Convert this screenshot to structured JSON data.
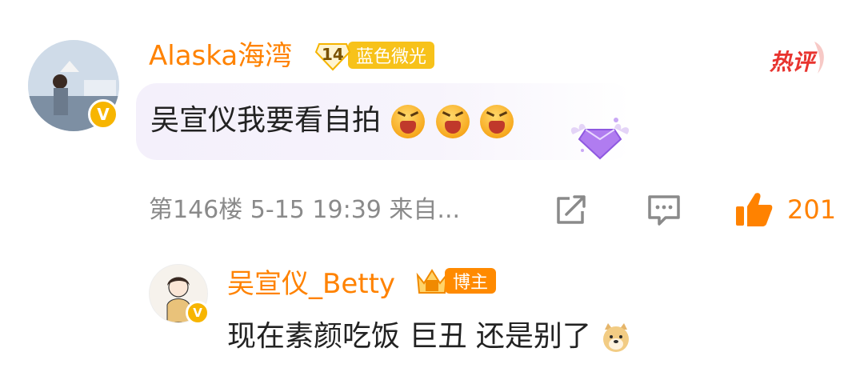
{
  "comment": {
    "username": "Alaska海湾",
    "level": "14",
    "badge_label": "蓝色微光",
    "hot_label": "热评",
    "text": "吴宣仪我要看自拍",
    "emoji_count": 3,
    "meta": "第146楼  5-15 19:39  来自...",
    "like_count": "201"
  },
  "reply": {
    "username": "吴宣仪_Betty",
    "badge_label": "博主",
    "text": "现在素颜吃饭 巨丑 还是别了"
  },
  "icons": {
    "share": "share-icon",
    "comment": "comment-icon",
    "like": "thumbs-up-icon",
    "verified": "verified-v-icon"
  },
  "colors": {
    "username": "#ff8200",
    "like": "#ff8200",
    "hot": "#e8342f",
    "badge": "#f5a623",
    "meta": "#8a8a8a"
  }
}
